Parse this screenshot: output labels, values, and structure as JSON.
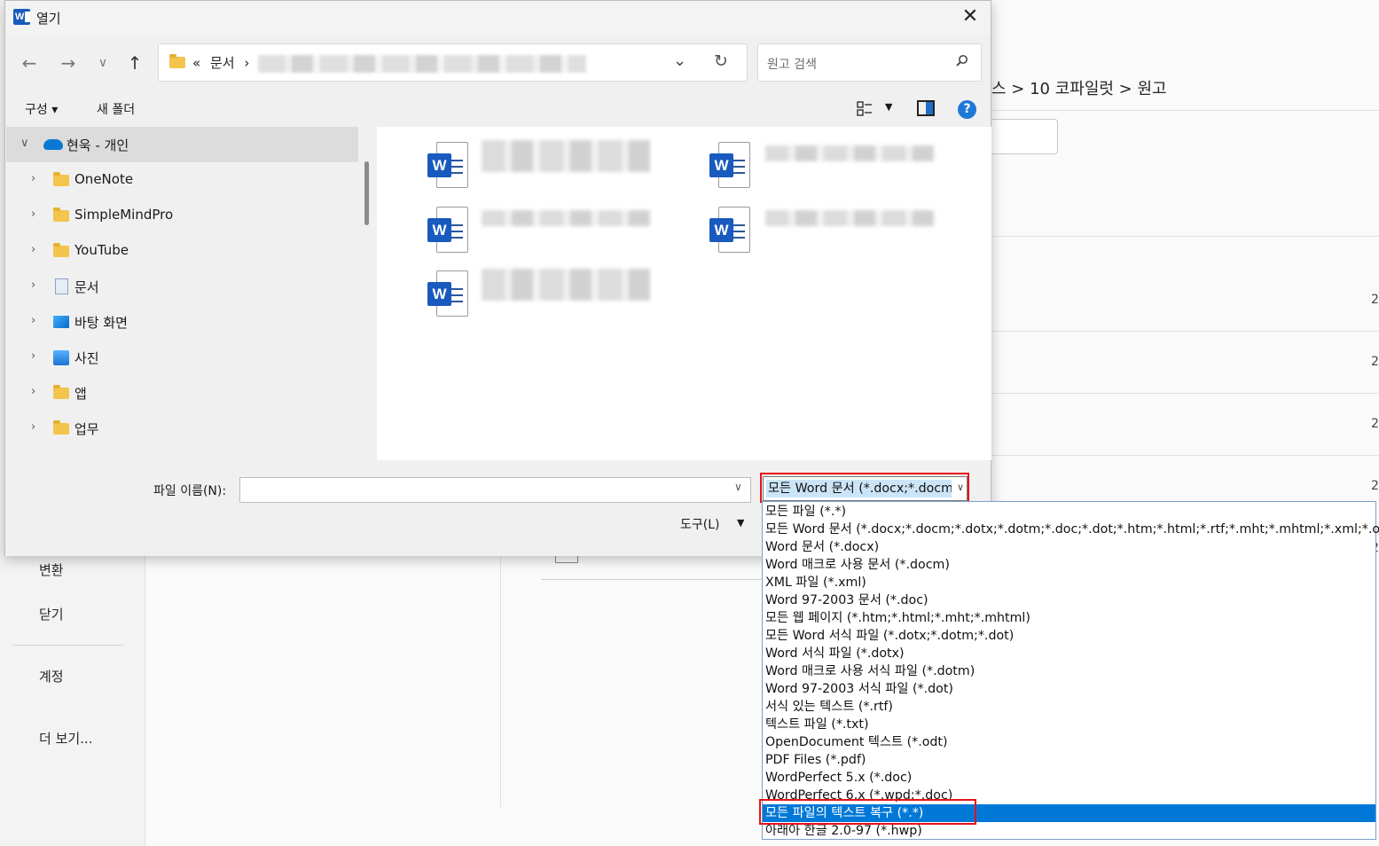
{
  "background": {
    "nav": {
      "convert": "변환",
      "close": "닫기",
      "account": "계정",
      "more": "더 보기..."
    },
    "breadcrumb": "스 > 10 코파일럿 > 원고",
    "edge_digit": "2"
  },
  "dialog": {
    "title": "열기",
    "address": {
      "overflow": "«",
      "crumb": "문서",
      "separator": "›"
    },
    "search": {
      "placeholder": "원고 검색"
    },
    "toolbar": {
      "organize": "구성 ▾",
      "new_folder": "새 폴더",
      "help": "?"
    },
    "tree": [
      {
        "label": "현욱 - 개인",
        "icon": "cloud-icon",
        "expanded": true
      },
      {
        "label": "OneNote",
        "icon": "folder-icon"
      },
      {
        "label": "SimpleMindPro",
        "icon": "folder-icon"
      },
      {
        "label": "YouTube",
        "icon": "folder-icon"
      },
      {
        "label": "문서",
        "icon": "documents-icon"
      },
      {
        "label": "바탕 화면",
        "icon": "desktop-icon"
      },
      {
        "label": "사진",
        "icon": "pictures-icon"
      },
      {
        "label": "앱",
        "icon": "folder-icon"
      },
      {
        "label": "업무",
        "icon": "folder-icon"
      }
    ],
    "files_icon": "word-document-icon",
    "file_name_label": "파일 이름(N):",
    "file_name_value": "",
    "tools_label": "도구(L)",
    "file_type": {
      "selected": "모든 Word 문서 (*.docx;*.docm",
      "options": [
        "모든 파일 (*.*)",
        "모든 Word 문서 (*.docx;*.docm;*.dotx;*.dotm;*.doc;*.dot;*.htm;*.html;*.rtf;*.mht;*.mhtml;*.xml;*.odt;*.pdf)",
        "Word 문서 (*.docx)",
        "Word 매크로 사용 문서 (*.docm)",
        "XML 파일 (*.xml)",
        "Word 97-2003 문서 (*.doc)",
        "모든 웹 페이지 (*.htm;*.html;*.mht;*.mhtml)",
        "모든 Word 서식 파일 (*.dotx;*.dotm;*.dot)",
        "Word 서식 파일 (*.dotx)",
        "Word 매크로 사용 서식 파일 (*.dotm)",
        "Word 97-2003 서식 파일 (*.dot)",
        "서식 있는 텍스트 (*.rtf)",
        "텍스트 파일 (*.txt)",
        "OpenDocument 텍스트 (*.odt)",
        "PDF Files (*.pdf)",
        "WordPerfect 5.x (*.doc)",
        "WordPerfect 6.x (*.wpd;*.doc)",
        "모든 파일의 텍스트 복구 (*.*)",
        "아래아 한글 2.0-97 (*.hwp)"
      ],
      "highlighted_index": 17
    }
  },
  "colors": {
    "accent": "#0078d7",
    "highlight_box": "#e8131c",
    "word_blue": "#185abd"
  }
}
